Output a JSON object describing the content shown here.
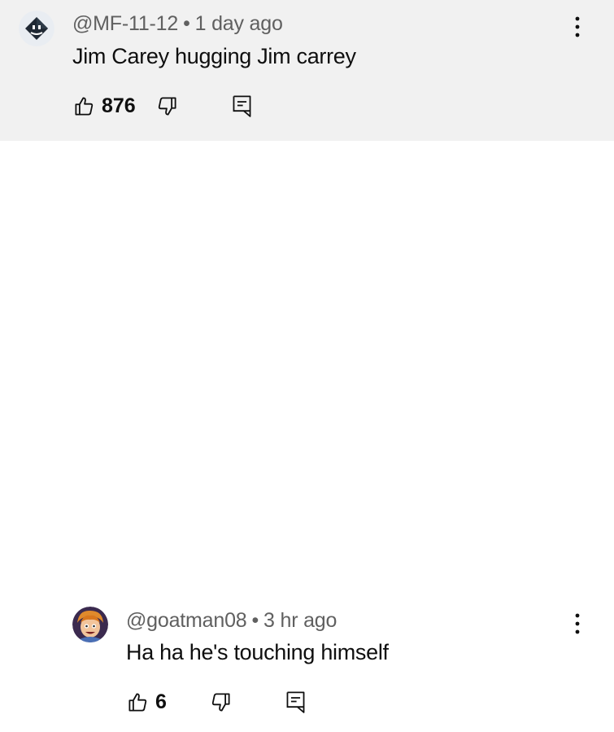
{
  "comments": [
    {
      "author": "@MF-11-12",
      "separator": "•",
      "time": "1 day ago",
      "text": "Jim Carey hugging Jim carrey",
      "likes": "876",
      "icons": {
        "avatar": "black-cube-character-avatar",
        "like": "thumbs-up-icon",
        "dislike": "thumbs-down-icon",
        "reply": "reply-comment-icon",
        "menu": "more-vertical-icon"
      }
    },
    {
      "author": "@goatman08",
      "separator": "•",
      "time": "3 hr ago",
      "text": "Ha ha he's touching himself",
      "likes": "6",
      "icons": {
        "avatar": "cartoon-face-avatar",
        "like": "thumbs-up-icon",
        "dislike": "thumbs-down-icon",
        "reply": "reply-comment-icon",
        "menu": "more-vertical-icon"
      }
    }
  ],
  "colors": {
    "highlight_background": "#f1f1f1",
    "meta_text": "#606060",
    "body_text": "#0f0f0f"
  }
}
